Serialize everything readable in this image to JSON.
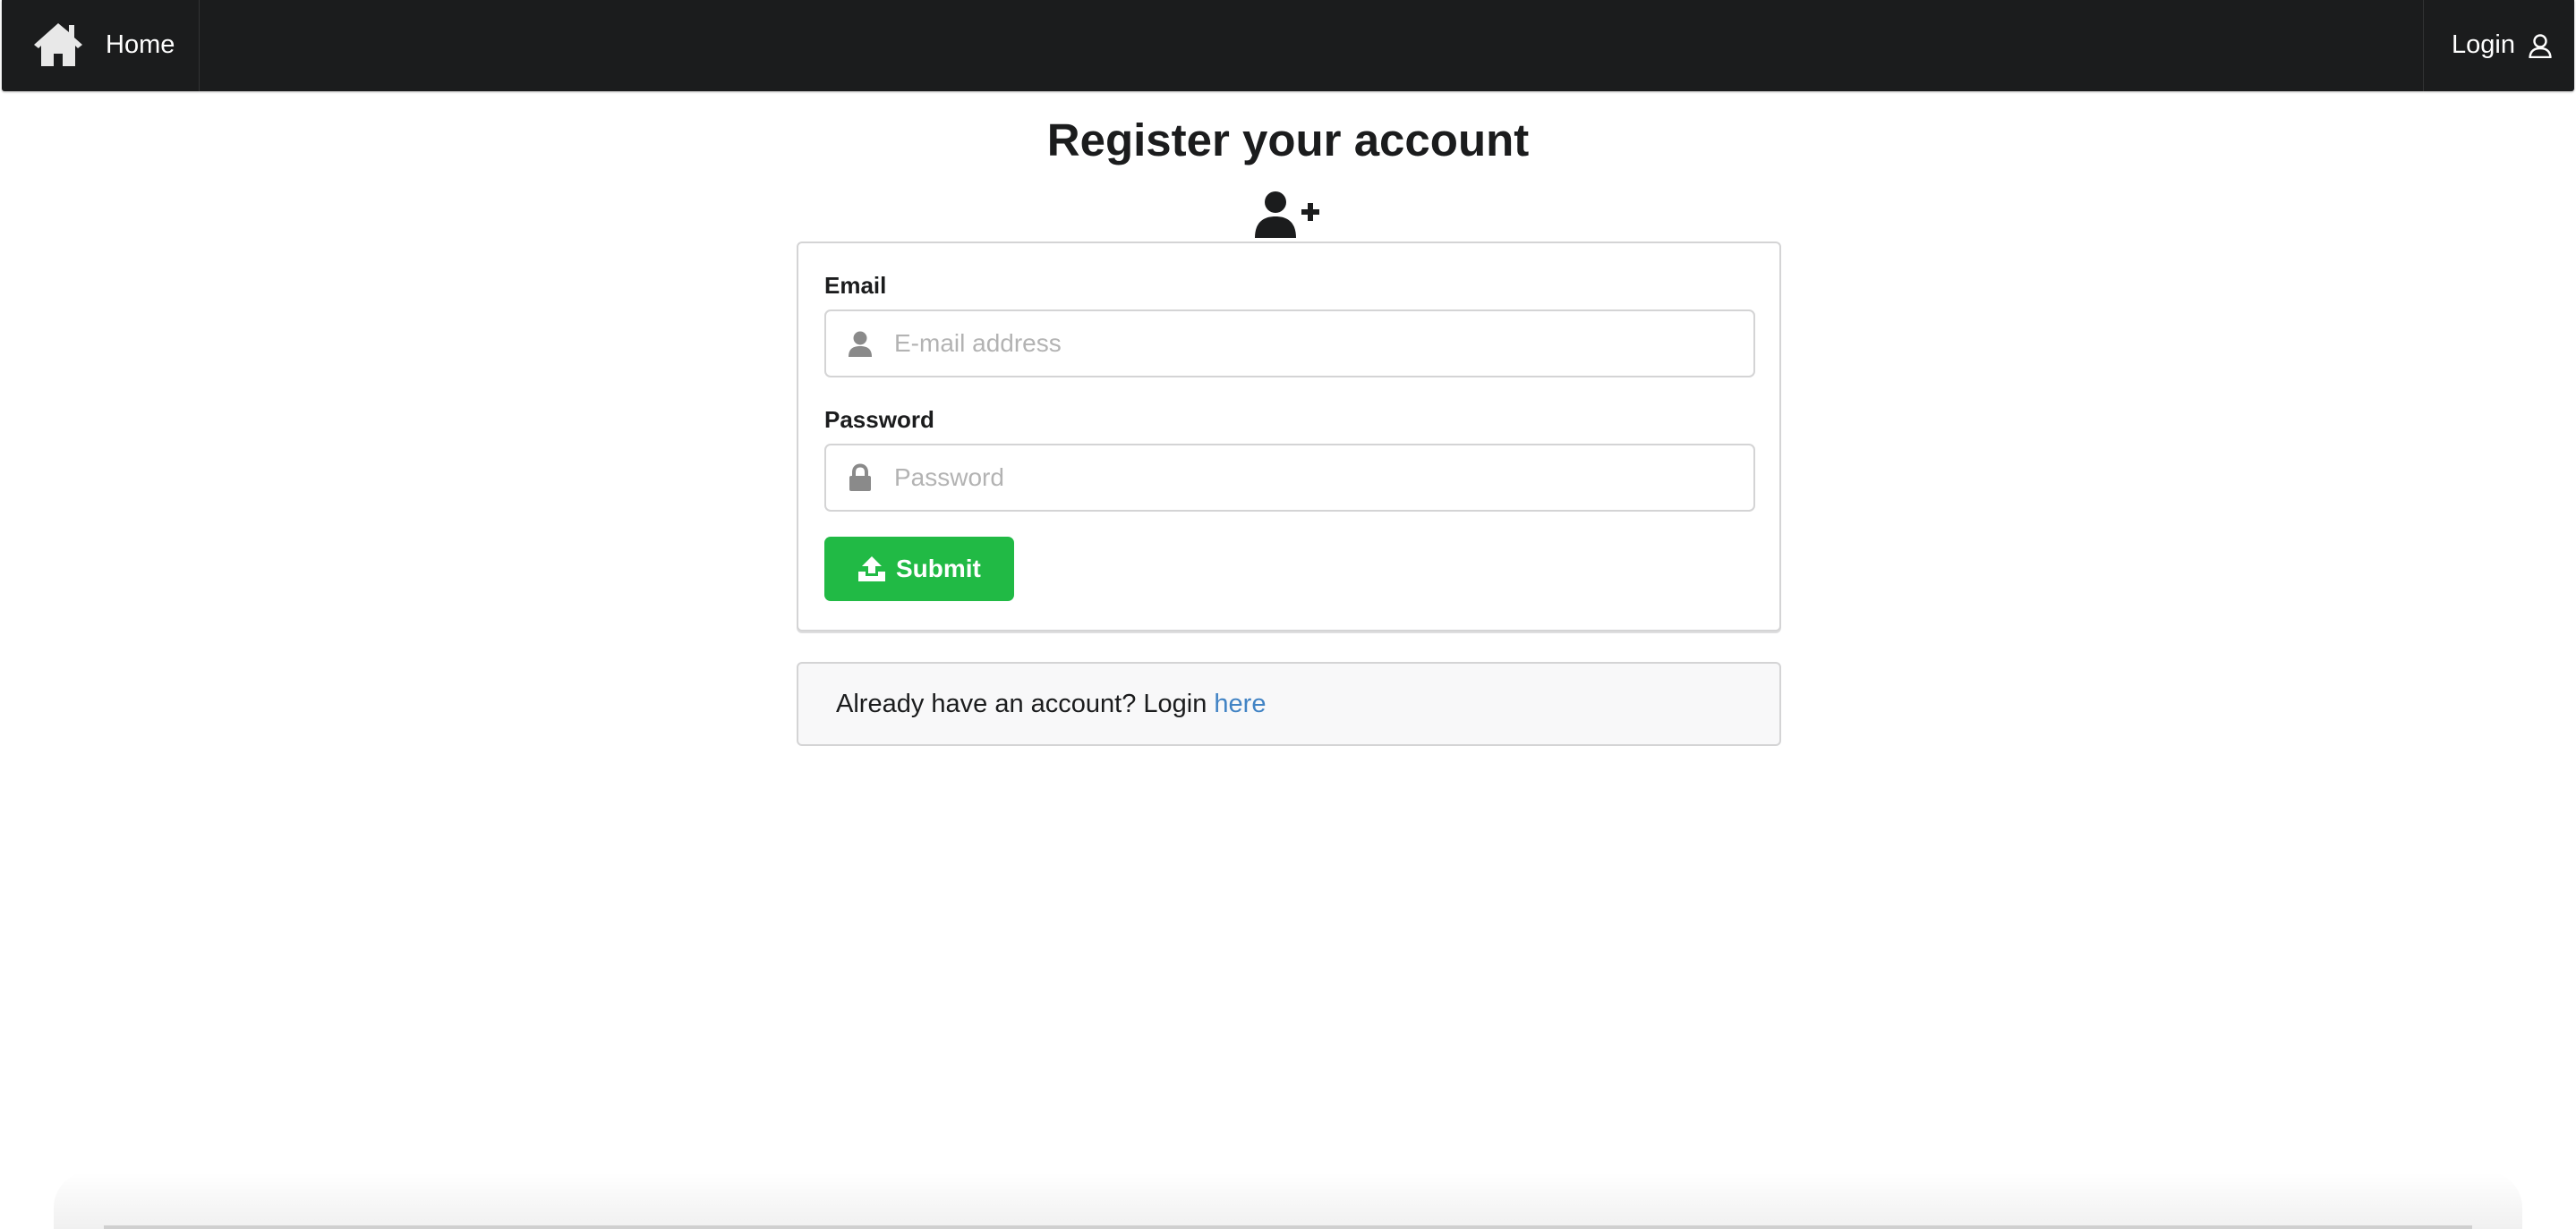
{
  "navbar": {
    "home_label": "Home",
    "home_icon": "home-icon",
    "login_label": "Login",
    "login_icon": "user-outline-icon",
    "background": "#1b1c1d"
  },
  "page": {
    "title": "Register your account",
    "title_icon": "user-plus-icon"
  },
  "form": {
    "email": {
      "label": "Email",
      "placeholder": "E-mail address",
      "value": "",
      "icon": "user-icon"
    },
    "password": {
      "label": "Password",
      "placeholder": "Password",
      "value": "",
      "icon": "lock-icon"
    },
    "submit": {
      "label": "Submit",
      "icon": "upload-icon",
      "color": "#21ba45"
    }
  },
  "message": {
    "text": "Already have an account? Login ",
    "link_text": "here",
    "link_color": "#4183c4"
  }
}
